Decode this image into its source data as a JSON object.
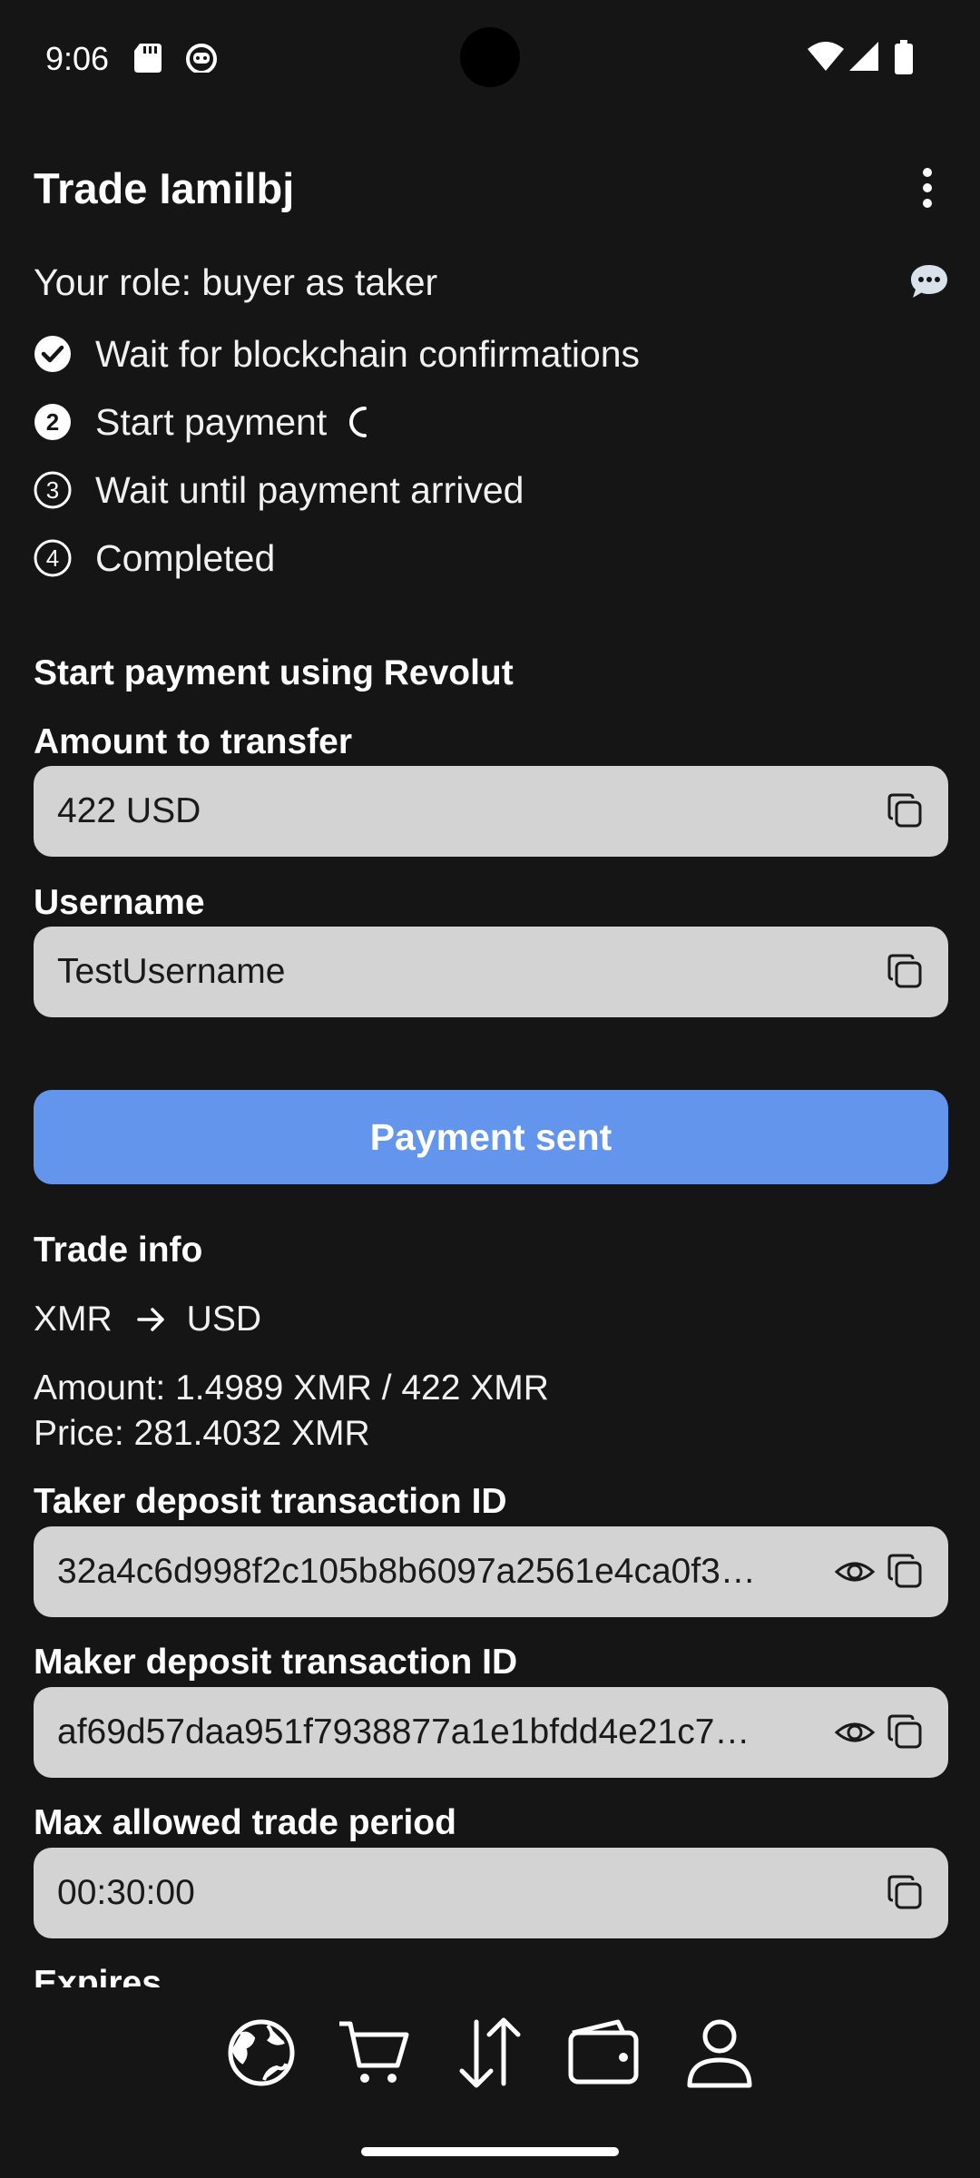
{
  "status_bar": {
    "time": "9:06"
  },
  "header": {
    "title": "Trade Iamilbj"
  },
  "role_text": "Your role: buyer as taker",
  "steps": [
    {
      "label": "Wait for blockchain confirmations",
      "state": "done"
    },
    {
      "label": "Start payment",
      "number": "2",
      "state": "active"
    },
    {
      "label": "Wait until payment arrived",
      "number": "3",
      "state": "pending"
    },
    {
      "label": "Completed",
      "number": "4",
      "state": "pending"
    }
  ],
  "payment": {
    "section_title": "Start payment using Revolut",
    "amount_label": "Amount to transfer",
    "amount_value": "422 USD",
    "username_label": "Username",
    "username_value": "TestUsername",
    "button_label": "Payment sent"
  },
  "trade_info": {
    "title": "Trade info",
    "from_currency": "XMR",
    "to_currency": "USD",
    "amount_line": "Amount: 1.4989 XMR / 422 XMR",
    "price_line": "Price: 281.4032 XMR",
    "taker_label": "Taker deposit transaction ID",
    "taker_value": "32a4c6d998f2c105b8b6097a2561e4ca0f3…",
    "maker_label": "Maker deposit transaction ID",
    "maker_value": "af69d57daa951f7938877a1e1bfdd4e21c7…",
    "period_label": "Max allowed trade period",
    "period_value": "00:30:00",
    "expires_label": "Expires"
  },
  "bottom_nav": [
    "globe-icon",
    "cart-icon",
    "swap-icon",
    "wallet-icon",
    "account-icon"
  ],
  "colors": {
    "background": "#151516",
    "field": "#d3d3d3",
    "accent": "#6495ed"
  }
}
